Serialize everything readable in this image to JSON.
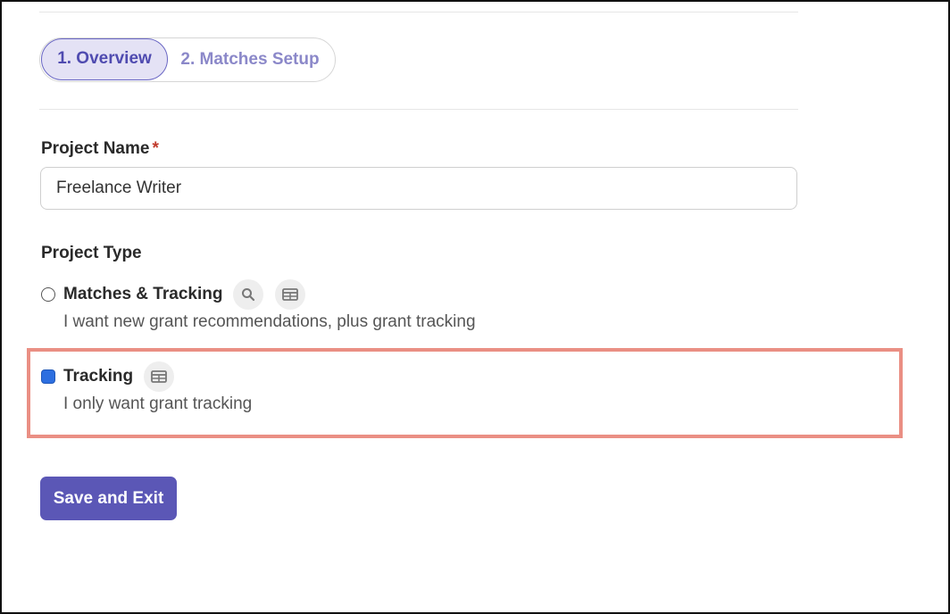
{
  "stepper": {
    "steps": [
      {
        "label": "1. Overview",
        "active": true
      },
      {
        "label": "2. Matches Setup",
        "active": false
      }
    ]
  },
  "form": {
    "project_name": {
      "label": "Project Name",
      "required_marker": "*",
      "value": "Freelance Writer"
    },
    "project_type": {
      "label": "Project Type",
      "options": [
        {
          "title": "Matches & Tracking",
          "description": "I want new grant recommendations, plus grant tracking",
          "selected": false,
          "icons": [
            "search-icon",
            "table-icon"
          ]
        },
        {
          "title": "Tracking",
          "description": "I only want grant tracking",
          "selected": true,
          "icons": [
            "table-icon"
          ]
        }
      ]
    }
  },
  "actions": {
    "save_label": "Save and Exit"
  },
  "colors": {
    "accent": "#5b57b6",
    "active_step_bg": "#e4e2f5",
    "selected_radio": "#2d6fe0",
    "highlight": "#ea8f84",
    "required": "#c0392b"
  }
}
